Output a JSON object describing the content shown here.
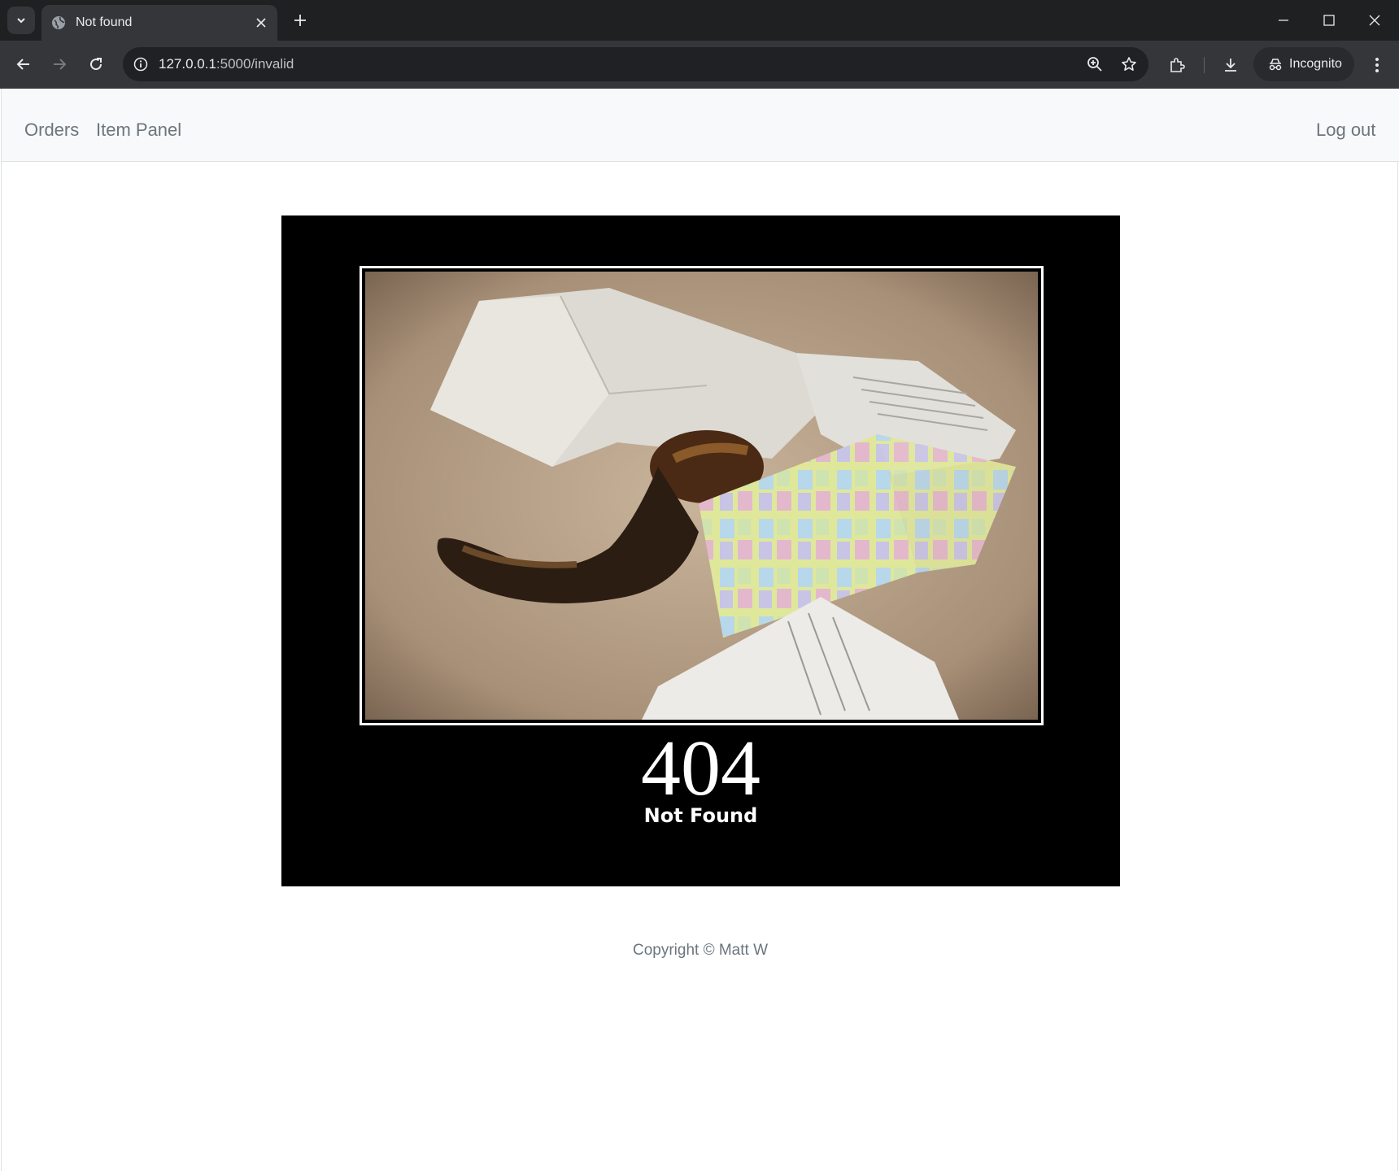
{
  "browser": {
    "tab_title": "Not found",
    "url_host": "127.0.0.1",
    "url_path": ":5000/invalid",
    "incognito_label": "Incognito"
  },
  "nav": {
    "orders": "Orders",
    "item_panel": "Item Panel",
    "logout": "Log out"
  },
  "error": {
    "code": "404",
    "message": "Not Found"
  },
  "footer": {
    "copyright": "Copyright © Matt W"
  }
}
